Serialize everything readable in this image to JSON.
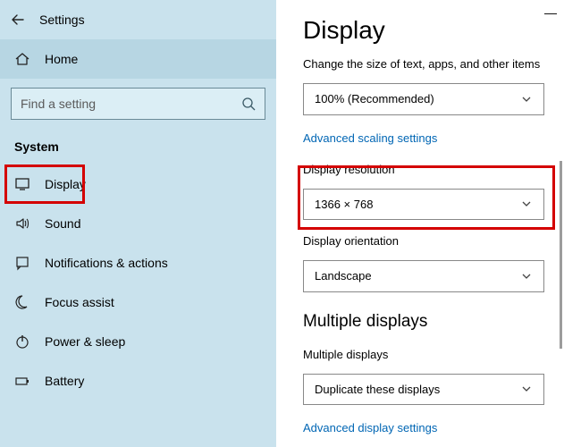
{
  "titlebar": {
    "title": "Settings"
  },
  "home": {
    "label": "Home"
  },
  "search": {
    "placeholder": "Find a setting"
  },
  "category": {
    "label": "System"
  },
  "nav": {
    "items": [
      {
        "label": "Display"
      },
      {
        "label": "Sound"
      },
      {
        "label": "Notifications & actions"
      },
      {
        "label": "Focus assist"
      },
      {
        "label": "Power & sleep"
      },
      {
        "label": "Battery"
      }
    ]
  },
  "main": {
    "heading": "Display",
    "scale_label": "Change the size of text, apps, and other items",
    "scale_value": "100% (Recommended)",
    "adv_scaling_link": "Advanced scaling settings",
    "resolution_label": "Display resolution",
    "resolution_value": "1366 × 768",
    "orientation_label": "Display orientation",
    "orientation_value": "Landscape",
    "multi_heading": "Multiple displays",
    "multi_label": "Multiple displays",
    "multi_value": "Duplicate these displays",
    "adv_display_link": "Advanced display settings"
  }
}
